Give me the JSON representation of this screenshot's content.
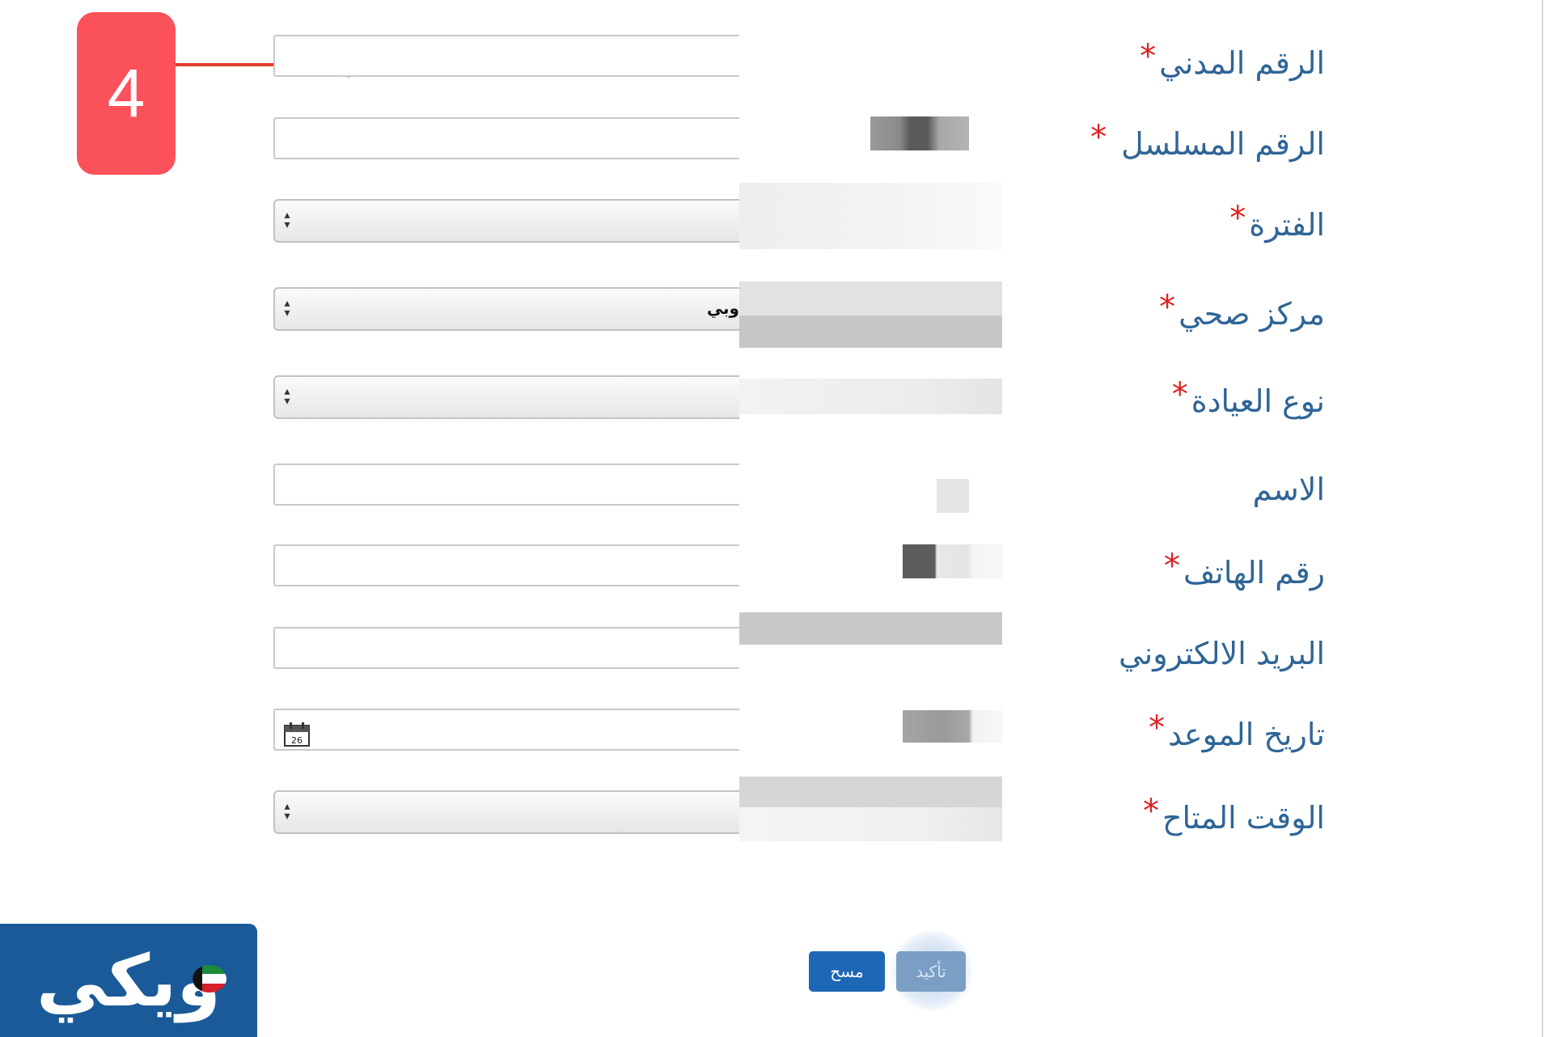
{
  "step_badge": {
    "number": "4"
  },
  "form": {
    "fields": [
      {
        "label": "الرقم المدني",
        "required": true,
        "kind": "text",
        "value": ""
      },
      {
        "label": "الرقم المسلسل",
        "required": true,
        "kind": "text",
        "value": ""
      },
      {
        "label": "الفترة",
        "required": true,
        "kind": "select",
        "value": ""
      },
      {
        "label": "مركز صحي",
        "required": true,
        "kind": "select",
        "value": "وبي"
      },
      {
        "label": "نوع العيادة",
        "required": true,
        "kind": "select",
        "value": ""
      },
      {
        "label": "الاسم",
        "required": false,
        "kind": "text",
        "value": ""
      },
      {
        "label": "رقم الهاتف",
        "required": true,
        "kind": "text",
        "value": ""
      },
      {
        "label": "البريد الالكتروني",
        "required": false,
        "kind": "text",
        "value": ""
      },
      {
        "label": "تاريخ الموعد",
        "required": true,
        "kind": "date",
        "value": ""
      },
      {
        "label": "الوقت المتاح",
        "required": true,
        "kind": "select",
        "value": ""
      }
    ],
    "required_mark": "*",
    "calendar_icon_day": "26"
  },
  "buttons": {
    "clear_label": "مسح",
    "confirm_label": "تأكيد"
  },
  "logo": {
    "text": "ويكي"
  },
  "colors": {
    "label": "#2f6596",
    "required": "#e02020",
    "badge": "#fb515b",
    "arrow": "#e23a2e",
    "button": "#1d67b6",
    "logo_bg": "#1a5a99"
  }
}
